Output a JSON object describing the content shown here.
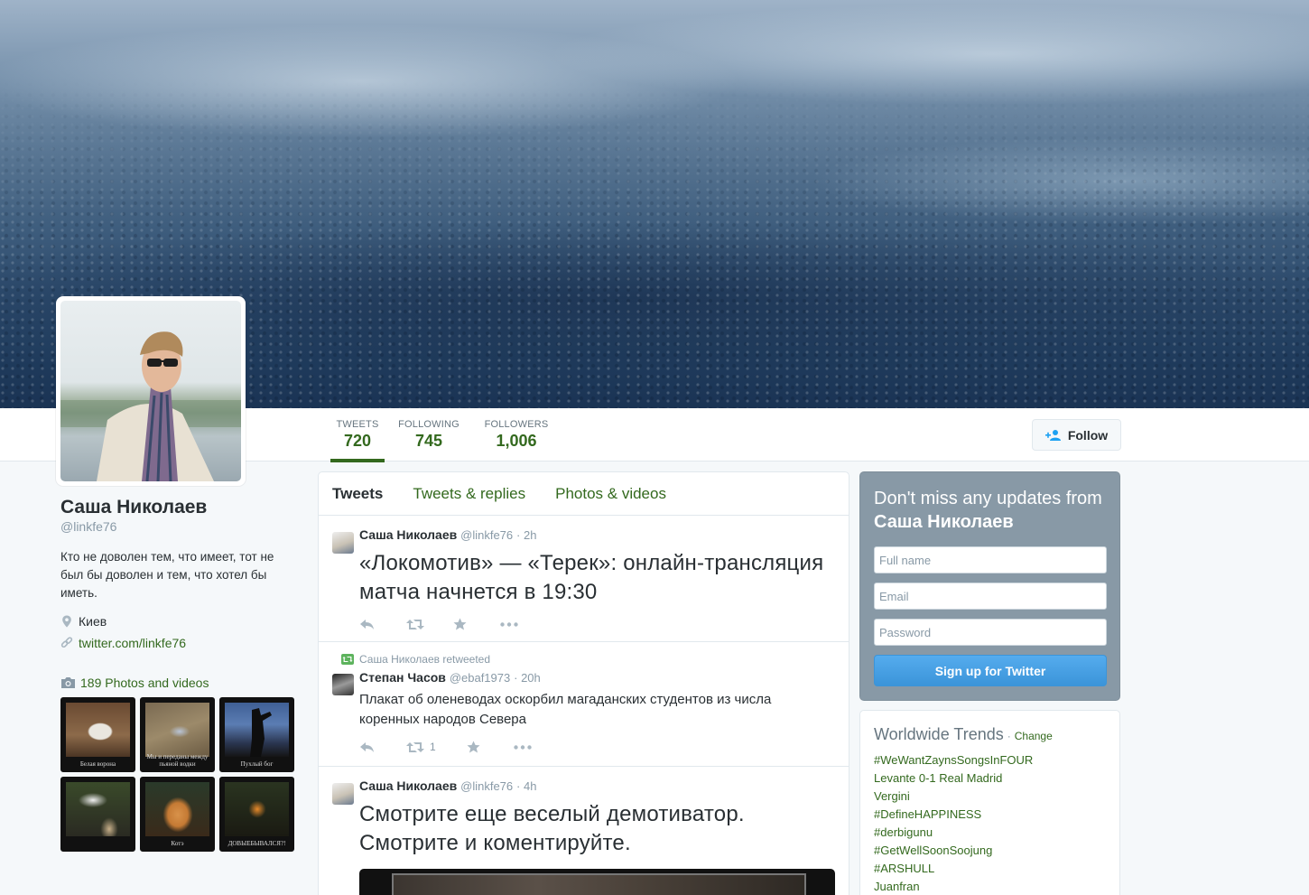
{
  "nav": {
    "stats": [
      {
        "label": "TWEETS",
        "value": "720"
      },
      {
        "label": "FOLLOWING",
        "value": "745"
      },
      {
        "label": "FOLLOWERS",
        "value": "1,006"
      }
    ],
    "follow_label": "Follow"
  },
  "profile": {
    "name": "Саша Николаев",
    "handle": "@linkfe76",
    "bio": "Кто не доволен тем, что имеет, тот не был бы доволен и тем, что хотел бы иметь.",
    "location": "Киев",
    "url": "twitter.com/linkfe76",
    "photos_label": "189 Photos and videos",
    "thumb_captions": [
      "Белая ворона",
      "Мы и переданы между пьяной водки",
      "Пухлый бог",
      "",
      "Котэ",
      "ДОВЫЕБЫВАЛСЯ?!"
    ]
  },
  "timeline": {
    "tabs": [
      "Tweets",
      "Tweets & replies",
      "Photos & videos"
    ],
    "tweets": [
      {
        "name": "Саша Николаев",
        "handle": "@linkfe76",
        "time": "· 2h",
        "text": "«Локомотив» — «Терек»: онлайн-трансляция матча начнется в 19:30"
      },
      {
        "retweet_note": "Саша Николаев retweeted",
        "name": "Степан Часов",
        "handle": "@ebaf1973",
        "time": "· 20h",
        "text": "Плакат об оленеводах оскорбил магаданских студентов из числа коренных народов Севера",
        "retweet_count": "1"
      },
      {
        "name": "Саша Николаев",
        "handle": "@linkfe76",
        "time": "· 4h",
        "text": "Смотрите еще веселый демотиватор. Смотрите и коментируйте."
      }
    ]
  },
  "signup": {
    "heading_prefix": "Don't miss any updates from",
    "heading_name": "Саша Николаев",
    "fullname_placeholder": "Full name",
    "email_placeholder": "Email",
    "password_placeholder": "Password",
    "button_label": "Sign up for Twitter"
  },
  "trends": {
    "title": "Worldwide Trends",
    "dot": "·",
    "change_label": "Change",
    "items": [
      "#WeWantZaynsSongsInFOUR",
      "Levante 0-1 Real Madrid",
      "Vergini",
      "#DefineHAPPINESS",
      "#derbigunu",
      "#GetWellSoonSoojung",
      "#ARSHULL",
      "Juanfran"
    ]
  },
  "colors": {
    "link": "#33691e",
    "signup_bg": "#8899a6",
    "signup_button": "#55acee"
  },
  "icons": [
    "follow-person-icon",
    "location-pin-icon",
    "link-icon",
    "camera-icon",
    "reply-icon",
    "retweet-icon",
    "favorite-star-icon",
    "more-dots-icon"
  ]
}
